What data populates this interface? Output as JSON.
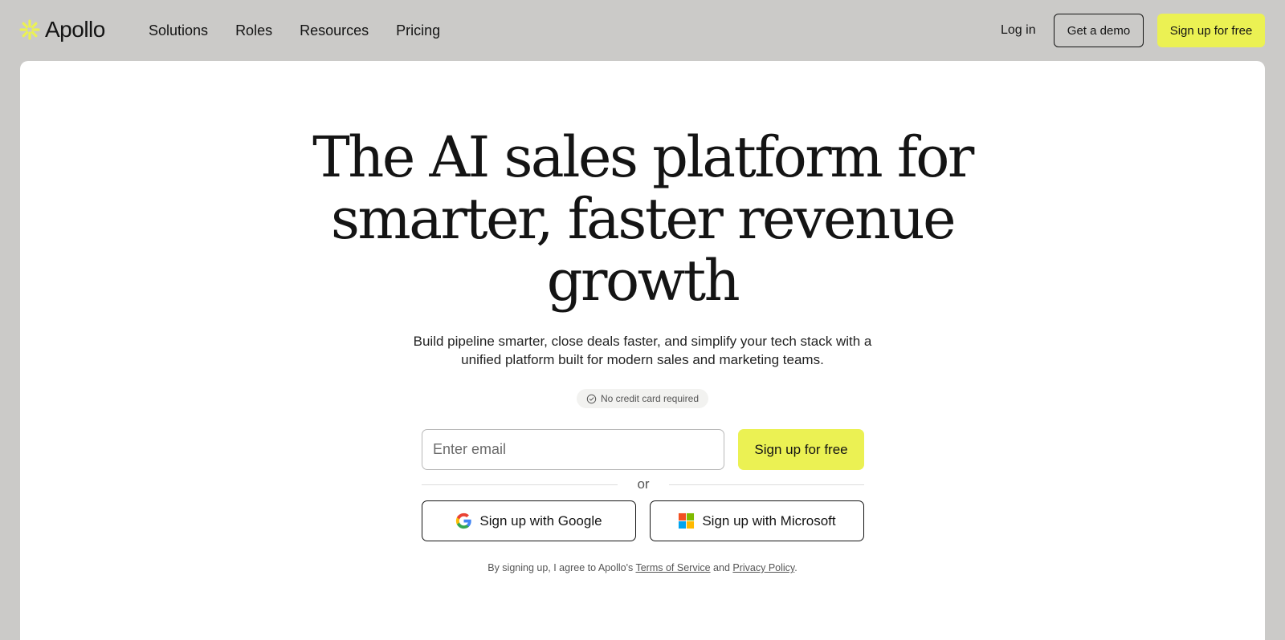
{
  "header": {
    "brand": "Apollo",
    "nav": [
      "Solutions",
      "Roles",
      "Resources",
      "Pricing"
    ],
    "login": "Log in",
    "demo": "Get a demo",
    "signup": "Sign up for free"
  },
  "hero": {
    "headline": [
      "The AI sales platform for",
      "smarter, faster revenue",
      "growth"
    ],
    "subtitle": "Build pipeline smarter, close deals faster, and simplify your tech stack with a unified platform built for modern sales and marketing teams.",
    "badge": "No credit card required",
    "email_placeholder": "Enter email",
    "signup": "Sign up for free",
    "divider": "or",
    "google": "Sign up with Google",
    "microsoft": "Sign up with Microsoft",
    "legal": {
      "prefix": "By signing up, I agree to Apollo's",
      "terms": "Terms of Service",
      "and": "and",
      "privacy": "Privacy Policy",
      "suffix": "."
    }
  },
  "colors": {
    "page_bg": "#cbcac8",
    "accent": "#ebf153",
    "text": "#141414",
    "logo_mark": "#ebf153"
  },
  "icons": {
    "logo": "apollo-star-icon",
    "badge": "check-circle-icon",
    "google": "google-g-icon",
    "microsoft": "microsoft-logo-icon"
  }
}
